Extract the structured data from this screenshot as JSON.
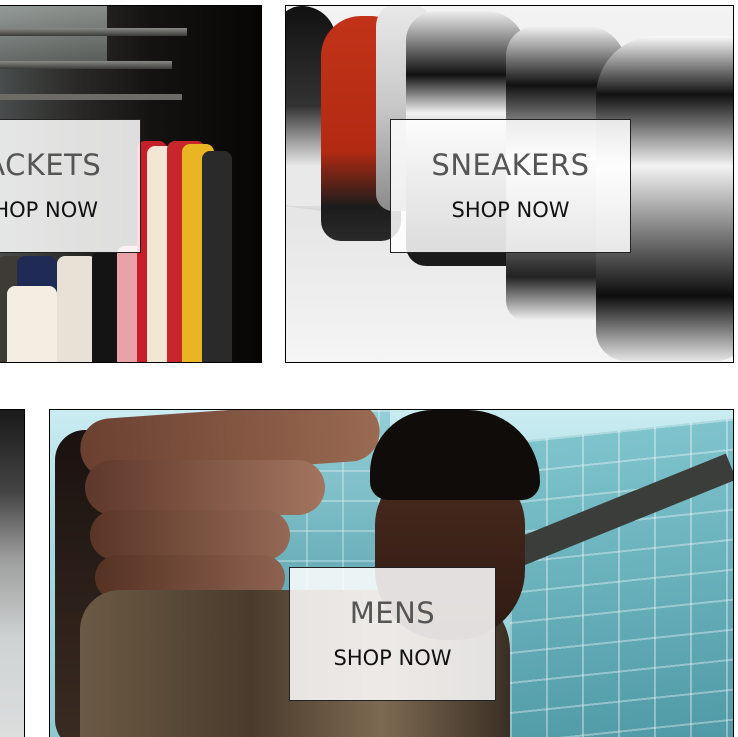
{
  "tiles": {
    "jackets": {
      "title": "JACKETS",
      "cta": "SHOP NOW"
    },
    "sneakers": {
      "title": "SNEAKERS",
      "cta": "SHOP NOW"
    },
    "mens": {
      "title": "MENS",
      "cta": "SHOP NOW"
    }
  },
  "colors": {
    "overlay": "#ffffff",
    "title_text": "#555555",
    "cta_text": "#111111",
    "border": "#000000"
  }
}
